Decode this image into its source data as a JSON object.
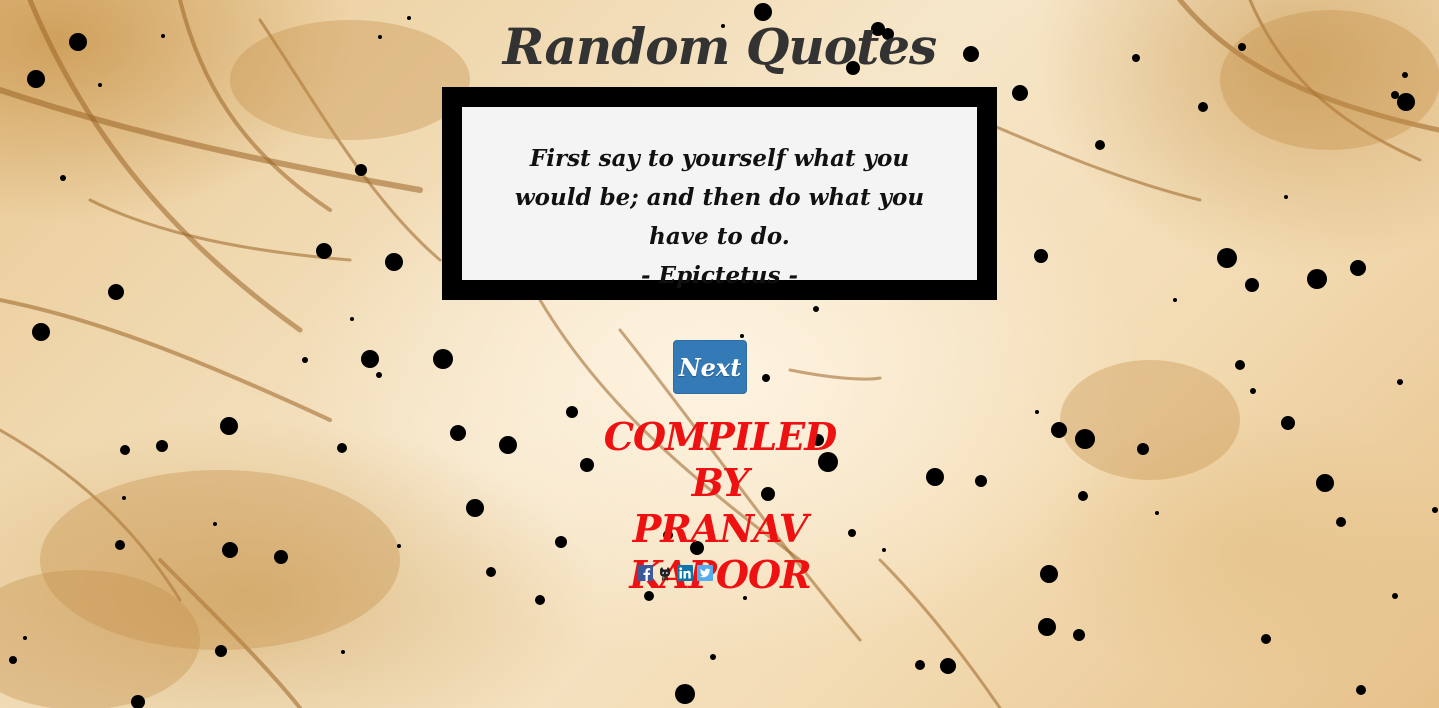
{
  "page": {
    "title": "Random Quotes"
  },
  "quote": {
    "text": "First say to yourself what you would be; and then do what you have to do.",
    "author_line": "-  Epictetus  -"
  },
  "next_button": {
    "label": "Next"
  },
  "credit": {
    "line1": "COMPILED BY",
    "line2": "PRANAV",
    "line3": "KAPOOR"
  },
  "social_links": [
    {
      "name": "facebook-icon",
      "color": "#3b5998"
    },
    {
      "name": "github-icon",
      "color": "#333333"
    },
    {
      "name": "linkedin-icon",
      "color": "#0e76a8"
    },
    {
      "name": "twitter-icon",
      "color": "#55acee"
    }
  ],
  "colors": {
    "title": "#333333",
    "frame": "#000000",
    "quote_bg": "#f4f4f4",
    "button": "#337ab7",
    "credit": "#ee1111"
  }
}
